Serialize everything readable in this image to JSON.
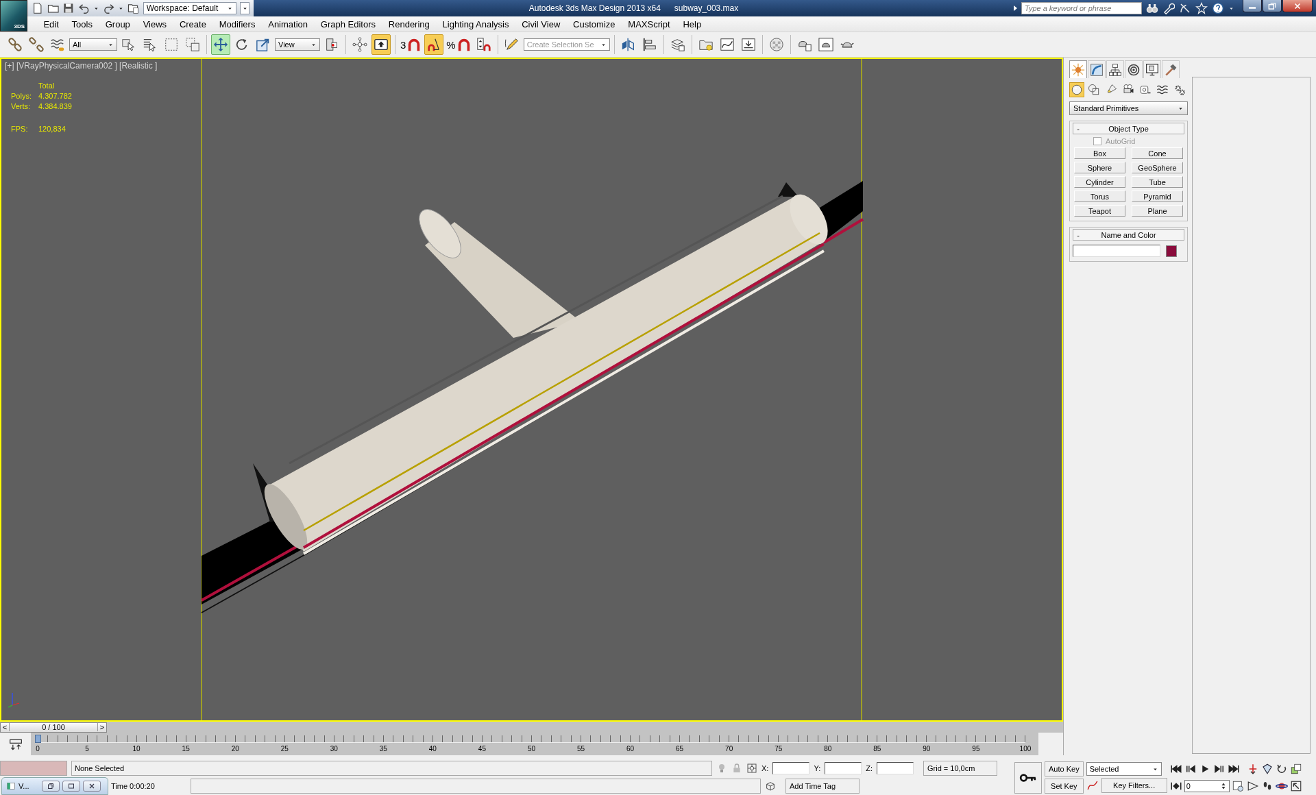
{
  "title_bar": {
    "app_badge": "3DS",
    "workspace": "Workspace: Default",
    "title": "Autodesk 3ds Max Design 2013 x64",
    "file": "subway_003.max",
    "search": {
      "placeholder": "Type a keyword or phrase"
    }
  },
  "menu": [
    "Edit",
    "Tools",
    "Group",
    "Views",
    "Create",
    "Modifiers",
    "Animation",
    "Graph Editors",
    "Rendering",
    "Lighting Analysis",
    "Civil View",
    "Customize",
    "MAXScript",
    "Help"
  ],
  "toolbar": [
    {
      "kind": "link",
      "selected": false
    },
    {
      "kind": "unlink",
      "selected": false
    },
    {
      "kind": "bind",
      "selected": false
    },
    {
      "kind": "dropdown",
      "value": "All"
    },
    {
      "kind": "select",
      "selected": false
    },
    {
      "kind": "select-name",
      "selected": false
    },
    {
      "kind": "rect-region",
      "selected": false
    },
    {
      "kind": "crossing",
      "selected": false
    },
    {
      "kind": "separator"
    },
    {
      "kind": "move",
      "selected": true
    },
    {
      "kind": "rotate",
      "selected": false
    },
    {
      "kind": "scale",
      "selected": false
    },
    {
      "kind": "dropdown",
      "value": "View"
    },
    {
      "kind": "pivot",
      "selected": false
    },
    {
      "kind": "separator"
    },
    {
      "kind": "manipulate",
      "selected": false
    },
    {
      "kind": "keyboard",
      "selected": true
    },
    {
      "kind": "separator"
    },
    {
      "kind": "snap",
      "label": "3",
      "selected": false
    },
    {
      "kind": "angle-snap",
      "selected": true
    },
    {
      "kind": "percent-snap",
      "label": "%",
      "selected": false
    },
    {
      "kind": "spinner-snap",
      "selected": false
    },
    {
      "kind": "separator"
    },
    {
      "kind": "named-sel",
      "selected": false
    },
    {
      "kind": "field",
      "placeholder": "Create Selection Se"
    },
    {
      "kind": "separator"
    },
    {
      "kind": "mirror",
      "selected": false
    },
    {
      "kind": "align",
      "selected": false
    },
    {
      "kind": "separator"
    },
    {
      "kind": "layers",
      "selected": false
    },
    {
      "kind": "separator"
    },
    {
      "kind": "scene-explorer",
      "selected": false
    },
    {
      "kind": "curve-editor",
      "selected": false
    },
    {
      "kind": "schematic",
      "selected": false
    },
    {
      "kind": "separator"
    },
    {
      "kind": "material",
      "selected": false
    },
    {
      "kind": "separator"
    },
    {
      "kind": "render-setup",
      "selected": false
    },
    {
      "kind": "render-frame",
      "selected": false
    },
    {
      "kind": "render",
      "selected": false
    }
  ],
  "viewport": {
    "label": "[+] [VRayPhysicalCamera002 ] [Realistic ]",
    "stats": {
      "header": "Total",
      "rows": [
        {
          "label": "Polys:",
          "value": "4.307.782"
        },
        {
          "label": "Verts:",
          "value": "4.384.839"
        }
      ],
      "fps_label": "FPS:",
      "fps": "120,834"
    }
  },
  "command_panel": {
    "tabs": [
      {
        "kind": "create",
        "selected": true
      },
      {
        "kind": "modify",
        "selected": false
      },
      {
        "kind": "hierarchy",
        "selected": false
      },
      {
        "kind": "motion",
        "selected": false
      },
      {
        "kind": "display",
        "selected": false
      },
      {
        "kind": "utilities",
        "selected": false
      }
    ],
    "categories": [
      {
        "kind": "geometry",
        "selected": true
      },
      {
        "kind": "shapes",
        "selected": false
      },
      {
        "kind": "lights",
        "selected": false
      },
      {
        "kind": "cameras",
        "selected": false
      },
      {
        "kind": "helpers",
        "selected": false
      },
      {
        "kind": "spacewarps",
        "selected": false
      },
      {
        "kind": "systems",
        "selected": false
      }
    ],
    "dropdown": "Standard Primitives",
    "object_type": {
      "toggle": "-",
      "title": "Object Type",
      "autogrid": {
        "label": "AutoGrid",
        "checked": false,
        "disabled": true
      },
      "buttons": [
        "Box",
        "Cone",
        "Sphere",
        "GeoSphere",
        "Cylinder",
        "Tube",
        "Torus",
        "Pyramid",
        "Teapot",
        "Plane"
      ]
    },
    "name_and_color": {
      "toggle": "-",
      "title": "Name and Color",
      "color": "#8a0c3c"
    }
  },
  "time_slider": {
    "prev": "<",
    "value": "0 / 100",
    "next": ">",
    "level": 0
  },
  "track_bar": {
    "ticks": [
      "0",
      "5",
      "10",
      "15",
      "20",
      "25",
      "30",
      "35",
      "40",
      "45",
      "50",
      "55",
      "60",
      "65",
      "70",
      "75",
      "80",
      "85",
      "90",
      "95",
      "100"
    ]
  },
  "status": {
    "listener_window": {
      "title": "V..."
    },
    "selection": "None Selected",
    "time_text": "Time 0:00:20",
    "x_label": "X:",
    "y_label": "Y:",
    "z_label": "Z:",
    "grid": "Grid = 10,0cm",
    "add_time_tag": "Add Time Tag"
  },
  "animation": {
    "auto_key": "Auto Key",
    "set_key": "Set Key",
    "key_set": "Selected",
    "key_filters": "Key Filters...",
    "frame": "0"
  }
}
